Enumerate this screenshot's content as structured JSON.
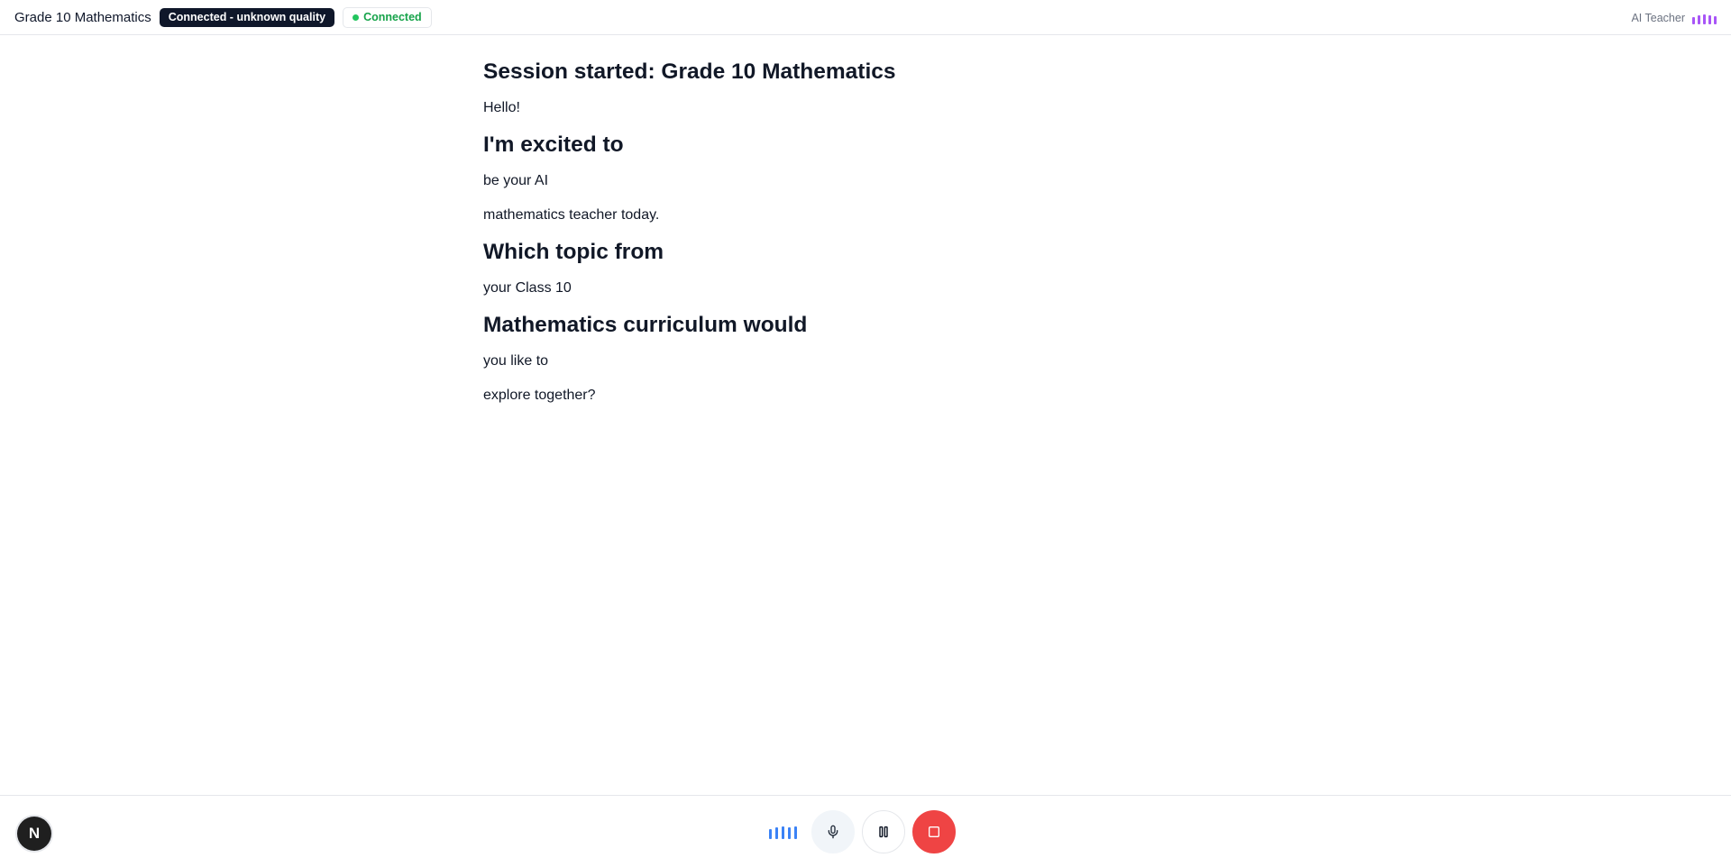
{
  "header": {
    "title": "Grade 10 Mathematics",
    "quality_badge": "Connected - unknown quality",
    "status_badge": "Connected",
    "teacher_label": "AI Teacher",
    "status_color": "#16a34a",
    "accent_purple": "#a855f7"
  },
  "transcript": {
    "lines": [
      {
        "style": "heading",
        "text": "Session started: Grade 10 Mathematics"
      },
      {
        "style": "paragraph",
        "text": "Hello!"
      },
      {
        "style": "heading",
        "text": "I'm excited to"
      },
      {
        "style": "paragraph",
        "text": "be your AI"
      },
      {
        "style": "paragraph",
        "text": "mathematics teacher today."
      },
      {
        "style": "heading",
        "text": "Which topic from"
      },
      {
        "style": "paragraph",
        "text": "your Class 10"
      },
      {
        "style": "heading",
        "text": "Mathematics curriculum would"
      },
      {
        "style": "paragraph",
        "text": "you like to"
      },
      {
        "style": "paragraph",
        "text": "explore together?"
      }
    ]
  },
  "footer": {
    "avatar_letter": "N",
    "icons": {
      "mic": "microphone-icon",
      "pause": "pause-icon",
      "stop": "stop-icon"
    },
    "stop_color": "#ef4444",
    "wave_color": "#3b82f6"
  }
}
